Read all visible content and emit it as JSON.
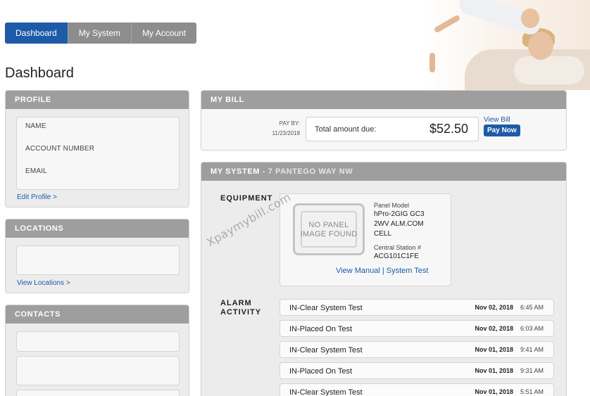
{
  "nav": {
    "tabs": [
      {
        "label": "Dashboard",
        "active": true
      },
      {
        "label": "My System",
        "active": false
      },
      {
        "label": "My Account",
        "active": false
      }
    ]
  },
  "page": {
    "title": "Dashboard"
  },
  "profile": {
    "heading": "PROFILE",
    "fields": [
      "NAME",
      "ACCOUNT NUMBER",
      "EMAIL"
    ],
    "edit_link": "Edit Profile >"
  },
  "locations": {
    "heading": "LOCATIONS",
    "view_link": "View Locations >"
  },
  "contacts": {
    "heading": "CONTACTS"
  },
  "bill": {
    "heading": "MY BILL",
    "pay_by_label": "PAY BY:",
    "pay_by_date": "11/23/2018",
    "total_label": "Total amount due:",
    "amount": "$52.50",
    "view_bill": "View Bill",
    "pay_now": "Pay Now"
  },
  "system": {
    "heading": "MY SYSTEM",
    "address": "- 7 PANTEGO WAY NW",
    "equipment_label": "EQUIPMENT",
    "no_image_line1": "NO PANEL",
    "no_image_line2": "IMAGE FOUND",
    "panel_model_label": "Panel Model",
    "panel_model_1": "hPro-2GIG GC3",
    "panel_model_2": "2WV ALM.COM",
    "panel_model_3": "CELL",
    "central_station_label": "Central Station #",
    "central_station": "ACG101C1FE",
    "view_manual": "View Manual",
    "separator": "|",
    "system_test": "System Test",
    "alarm_label_1": "ALARM",
    "alarm_label_2": "ACTIVITY",
    "alarms": [
      {
        "event": "IN-Clear System Test",
        "date": "Nov 02, 2018",
        "time": "6:45 AM"
      },
      {
        "event": "IN-Placed On Test",
        "date": "Nov 02, 2018",
        "time": "6:03 AM"
      },
      {
        "event": "IN-Clear System Test",
        "date": "Nov 01, 2018",
        "time": "9:41 AM"
      },
      {
        "event": "IN-Placed On Test",
        "date": "Nov 01, 2018",
        "time": "9:31 AM"
      },
      {
        "event": "IN-Clear System Test",
        "date": "Nov 01, 2018",
        "time": "5:51 AM"
      }
    ]
  },
  "watermark": "Xpaymybill.com",
  "colors": {
    "accent": "#1d5ba8",
    "panel_header": "#9e9e9e",
    "nav_inactive": "#8d8d8d"
  }
}
